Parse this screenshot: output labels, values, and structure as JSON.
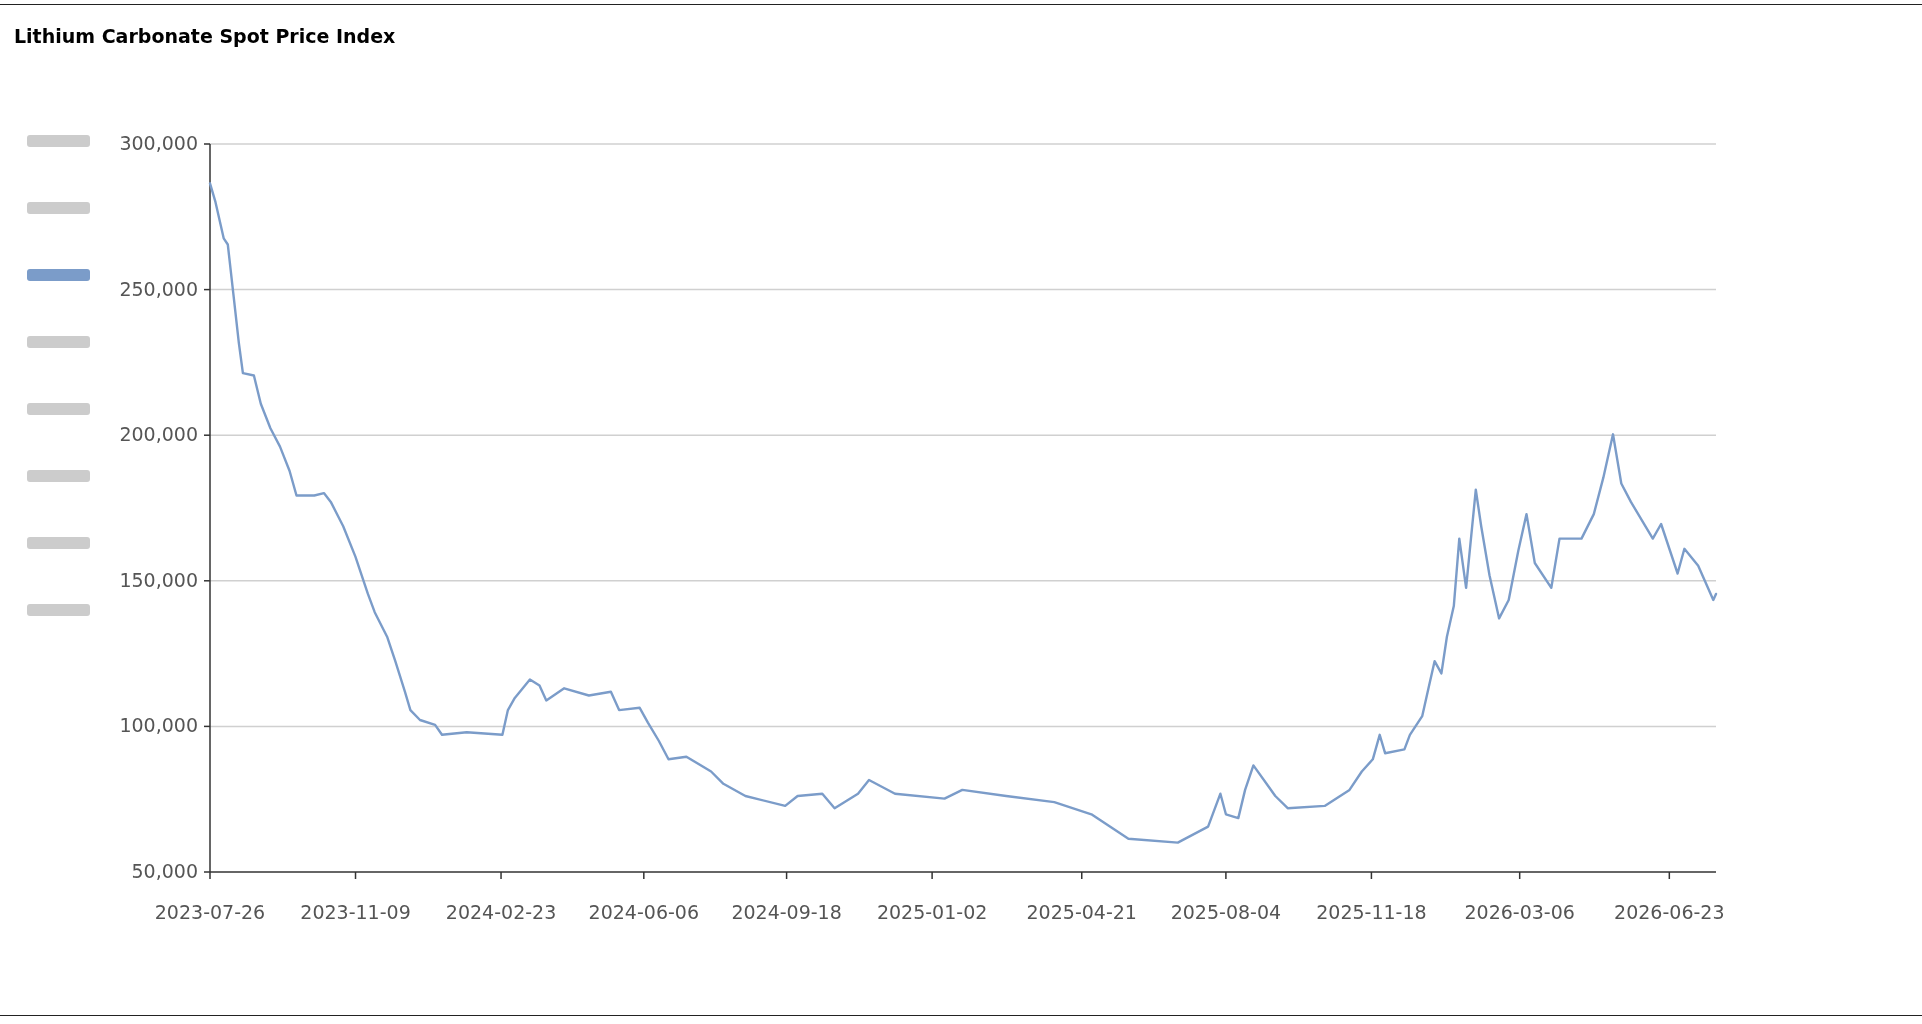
{
  "legend": {
    "items": [
      {
        "selected": false
      },
      {
        "selected": false
      },
      {
        "selected": true
      },
      {
        "selected": false
      },
      {
        "selected": false
      },
      {
        "selected": false
      },
      {
        "selected": false
      },
      {
        "selected": false
      }
    ]
  },
  "chart_data": {
    "type": "line",
    "grid": true,
    "title": "Lithium Carbonate Spot Price Index",
    "xlim": [
      "2023-07-26",
      "2026-07-27"
    ],
    "ylim": [
      50000,
      300000
    ],
    "yticks": [
      {
        "value": 50000,
        "label": "50,000"
      },
      {
        "value": 100000,
        "label": "100,000"
      },
      {
        "value": 150000,
        "label": "150,000"
      },
      {
        "value": 200000,
        "label": "200,000"
      },
      {
        "value": 250000,
        "label": "250,000"
      },
      {
        "value": 300000,
        "label": "300,000"
      }
    ],
    "xticks": [
      "2023-07-26",
      "2023-11-09",
      "2024-02-23",
      "2024-06-06",
      "2024-09-18",
      "2025-01-02",
      "2025-04-21",
      "2025-08-04",
      "2025-11-18",
      "2026-03-06",
      "2026-06-23"
    ],
    "x": [
      "2023-07-26",
      "2023-07-30",
      "2023-08-05",
      "2023-08-08",
      "2023-08-12",
      "2023-08-16",
      "2023-08-19",
      "2023-08-27",
      "2023-09-01",
      "2023-09-08",
      "2023-09-15",
      "2023-09-22",
      "2023-09-27",
      "2023-10-10",
      "2023-10-17",
      "2023-10-22",
      "2023-10-31",
      "2023-11-09",
      "2023-11-18",
      "2023-11-23",
      "2023-12-02",
      "2023-12-08",
      "2023-12-15",
      "2023-12-19",
      "2023-12-26",
      "2024-01-06",
      "2024-01-11",
      "2024-01-29",
      "2024-02-24",
      "2024-02-28",
      "2024-03-04",
      "2024-03-15",
      "2024-03-22",
      "2024-03-27",
      "2024-04-09",
      "2024-04-27",
      "2024-05-13",
      "2024-05-19",
      "2024-06-03",
      "2024-06-09",
      "2024-06-17",
      "2024-06-24",
      "2024-07-07",
      "2024-07-25",
      "2024-08-03",
      "2024-08-19",
      "2024-09-17",
      "2024-09-26",
      "2024-10-14",
      "2024-10-23",
      "2024-11-09",
      "2024-11-17",
      "2024-12-06",
      "2025-01-11",
      "2025-01-24",
      "2025-02-25",
      "2025-04-01",
      "2025-04-28",
      "2025-05-25",
      "2025-06-30",
      "2025-07-22",
      "2025-07-31",
      "2025-08-04",
      "2025-08-13",
      "2025-08-18",
      "2025-08-24",
      "2025-09-09",
      "2025-09-18",
      "2025-10-15",
      "2025-11-02",
      "2025-11-11",
      "2025-11-19",
      "2025-11-24",
      "2025-11-28",
      "2025-12-12",
      "2025-12-16",
      "2025-12-25",
      "2025-12-30",
      "2026-01-03",
      "2026-01-08",
      "2026-01-12",
      "2026-01-17",
      "2026-01-21",
      "2026-01-26",
      "2026-02-02",
      "2026-02-06",
      "2026-02-12",
      "2026-02-19",
      "2026-02-26",
      "2026-03-05",
      "2026-03-11",
      "2026-03-17",
      "2026-03-29",
      "2026-04-04",
      "2026-04-20",
      "2026-04-29",
      "2026-05-06",
      "2026-05-13",
      "2026-05-19",
      "2026-05-26",
      "2026-06-11",
      "2026-06-17",
      "2026-06-29",
      "2026-07-04",
      "2026-07-14",
      "2026-07-25",
      "2026-07-27"
    ],
    "series": [
      {
        "color": "#7b9cc9",
        "values": [
          286500,
          280000,
          267600,
          265500,
          248700,
          231800,
          221300,
          220500,
          210800,
          202400,
          196100,
          187700,
          179300,
          179300,
          180100,
          177100,
          168700,
          158200,
          145500,
          139200,
          130800,
          122400,
          111900,
          105600,
          102200,
          100500,
          97100,
          98000,
          97100,
          105600,
          109800,
          116100,
          114000,
          108900,
          113100,
          110600,
          111900,
          105600,
          106400,
          101300,
          95000,
          88700,
          89600,
          84500,
          80300,
          76100,
          72700,
          76100,
          76900,
          71900,
          76900,
          81600,
          76900,
          75200,
          78200,
          76100,
          74000,
          69800,
          61400,
          60100,
          65600,
          76900,
          69800,
          68500,
          78200,
          86600,
          76100,
          71900,
          72700,
          78200,
          84500,
          88700,
          97100,
          90800,
          92100,
          97100,
          103500,
          114000,
          122400,
          118200,
          130800,
          141300,
          164500,
          147600,
          181300,
          168700,
          151900,
          137100,
          143400,
          160300,
          172900,
          156100,
          147600,
          164500,
          164500,
          172900,
          185500,
          200300,
          183400,
          177100,
          164500,
          169500,
          152500,
          161000,
          155200,
          143400,
          145500
        ]
      }
    ]
  }
}
